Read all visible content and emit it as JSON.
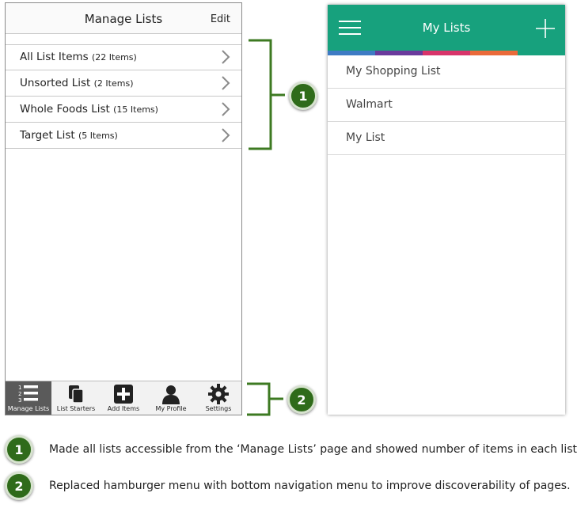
{
  "left_screen": {
    "title": "Manage Lists",
    "edit_label": "Edit",
    "lists": [
      {
        "name": "All List Items",
        "count": "(22 Items)"
      },
      {
        "name": "Unsorted List",
        "count": "(2 Items)"
      },
      {
        "name": "Whole Foods List",
        "count": "(15 Items)"
      },
      {
        "name": "Target List",
        "count": "(5 Items)"
      }
    ],
    "tabs": [
      {
        "label": "Manage Lists",
        "icon": "numbered-list-icon",
        "active": true
      },
      {
        "label": "List Starters",
        "icon": "documents-icon",
        "active": false
      },
      {
        "label": "Add Items",
        "icon": "plus-box-icon",
        "active": false
      },
      {
        "label": "My Profile",
        "icon": "person-icon",
        "active": false
      },
      {
        "label": "Settings",
        "icon": "gear-icon",
        "active": false
      }
    ]
  },
  "right_screen": {
    "title": "My Lists",
    "header_color": "#17a17d",
    "stripe_colors": [
      "#3e7bc4",
      "#6a3a9c",
      "#d8346a",
      "#ea6a3a",
      "#17a17d"
    ],
    "lists": [
      "My Shopping List",
      "Walmart",
      "My List"
    ]
  },
  "annotations": [
    {
      "number": "1",
      "text": "Made all lists accessible from the ‘Manage Lists’ page and showed number of items in each list."
    },
    {
      "number": "2",
      "text": "Replaced hamburger menu with bottom navigation menu to improve discoverability of pages."
    }
  ],
  "accent_color": "#2f6b1a"
}
